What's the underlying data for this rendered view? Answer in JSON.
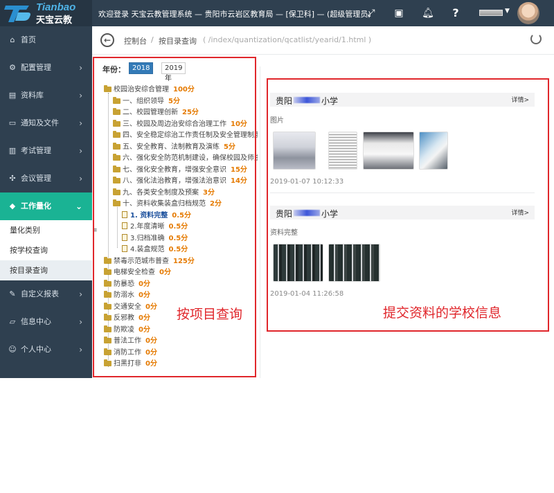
{
  "header": {
    "logo_en": "Tianbao",
    "logo_cn": "天宝云教",
    "welcome": "欢迎登录 天宝云教管理系统 — 贵阳市云岩区教育局 — [保卫科] — (超级管理员)",
    "icons": [
      "expand-icon",
      "qrcode-icon",
      "bell-icon",
      "help-icon"
    ]
  },
  "sidebar": {
    "items": [
      {
        "label": "首页",
        "icon": "home-icon"
      },
      {
        "label": "配置管理",
        "icon": "gear-icon"
      },
      {
        "label": "资料库",
        "icon": "document-icon"
      },
      {
        "label": "通知及文件",
        "icon": "folder-icon"
      },
      {
        "label": "考试管理",
        "icon": "book-icon"
      },
      {
        "label": "会议管理",
        "icon": "group-icon"
      },
      {
        "label": "工作量化",
        "icon": "cube-icon"
      },
      {
        "label": "自定义报表",
        "icon": "edit-icon"
      },
      {
        "label": "信息中心",
        "icon": "folder-open-icon"
      },
      {
        "label": "个人中心",
        "icon": "user-icon"
      }
    ],
    "sub_items": [
      {
        "label": "量化类别"
      },
      {
        "label": "按学校查询"
      },
      {
        "label": "按目录查询"
      }
    ]
  },
  "breadcrumb": {
    "home": "控制台",
    "separator": "/",
    "current": "按目录查询",
    "path": "( /index/quantization/qcatlist/yearid/1.html )"
  },
  "year": {
    "label": "年份：",
    "options": [
      "2018年",
      "2019年"
    ],
    "selected": "2018年"
  },
  "tree": [
    {
      "label": "校园治安综合管理",
      "score": "100分"
    },
    {
      "label": "一、组织领导",
      "score": "5分"
    },
    {
      "label": "二、校园管理创新",
      "score": "25分"
    },
    {
      "label": "三、校园及周边治安综合治理工作",
      "score": "10分"
    },
    {
      "label": "四、安全稳定综治工作责任制及安全管理制度",
      "score": ""
    },
    {
      "label": "五、安全教育、法制教育及演练",
      "score": "5分"
    },
    {
      "label": "六、强化安全防范机制建设，确保校园及师生",
      "score": ""
    },
    {
      "label": "七、强化安全教育，增强安全意识",
      "score": "15分"
    },
    {
      "label": "八、强化法治教育，增强法治意识",
      "score": "14分"
    },
    {
      "label": "九、各类安全制度及预案",
      "score": "3分"
    },
    {
      "label": "十、资料收集装盒归档规范",
      "score": "2分"
    },
    {
      "label": "1. 资料完整",
      "score": "0.5分"
    },
    {
      "label": "2.年度清晰",
      "score": "0.5分"
    },
    {
      "label": "3.归档准确",
      "score": "0.5分"
    },
    {
      "label": "4.装盒规范",
      "score": "0.5分"
    },
    {
      "label": "禁毒示范城市普查",
      "score": "125分"
    },
    {
      "label": "电梯安全检查",
      "score": "0分"
    },
    {
      "label": "防暴恐",
      "score": "0分"
    },
    {
      "label": "防溺水",
      "score": "0分"
    },
    {
      "label": "交通安全",
      "score": "0分"
    },
    {
      "label": "反邪教",
      "score": "0分"
    },
    {
      "label": "防欺凌",
      "score": "0分"
    },
    {
      "label": "普法工作",
      "score": "0分"
    },
    {
      "label": "消防工作",
      "score": "0分"
    },
    {
      "label": "扫黑打非",
      "score": "0分"
    }
  ],
  "cards": [
    {
      "school_prefix": "贵阳",
      "school_suffix": "小学",
      "detail": "详情>",
      "label": "图片",
      "time": "2019-01-07 10:12:33"
    },
    {
      "school_prefix": "贵阳",
      "school_suffix": "小学",
      "detail": "详情>",
      "label": "资料完整",
      "time": "2019-01-04 11:26:58"
    }
  ],
  "annotations": {
    "left": "按项目查询",
    "right": "提交资料的学校信息"
  },
  "colors": {
    "header_bg": "#2f4050",
    "active_nav": "#1ab394",
    "year_active": "#337ab7",
    "score": "#e57a00",
    "annotation": "#e0262b"
  }
}
